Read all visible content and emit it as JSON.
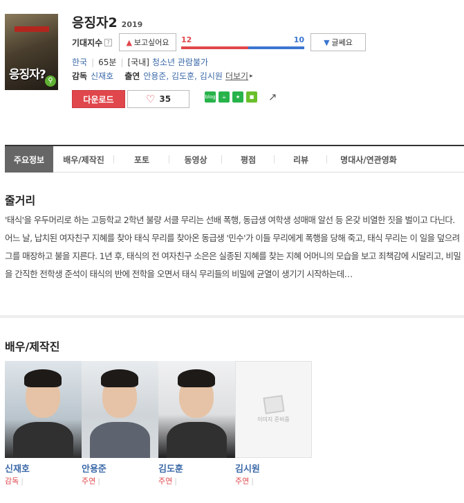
{
  "movie": {
    "title": "응징자2",
    "year": "2019",
    "poster_text": "응징자?"
  },
  "expect": {
    "label": "기대지수",
    "help": "?",
    "want_label": "보고싶어요",
    "dunno_label": "글쎄요",
    "want_count": "12",
    "dunno_count": "10",
    "want_ratio": 0.545
  },
  "meta": {
    "country": "한국",
    "runtime": "65분",
    "rating_prefix": "[국내]",
    "rating": "청소년 관람불가",
    "director_label": "감독",
    "director": "신재호",
    "cast_label": "출연",
    "cast_list": "안용준, 김도훈, 김시원",
    "more_label": "더보기"
  },
  "actions": {
    "download_label": "다운로드",
    "like_count": "35",
    "share_items": [
      "blog",
      "cafe",
      "star",
      "me"
    ]
  },
  "tabs": [
    {
      "label": "주요정보"
    },
    {
      "label": "배우/제작진"
    },
    {
      "label": "포토"
    },
    {
      "label": "동영상"
    },
    {
      "label": "평점"
    },
    {
      "label": "리뷰"
    },
    {
      "label": "명대사/연관영화"
    }
  ],
  "synopsis": {
    "title": "줄거리",
    "text": "'태식'을 우두머리로 하는 고등학교 2학년 불량 서클 무리는 선배 폭행, 동급생 여학생 성매매 알선 등 온갖 비열한 짓을 벌이고 다닌다. 어느 날, 납치된 여자친구 지혜를 찾아 태식 무리를 찾아온 동급생 '민수'가 이들 무리에게 폭행을 당해 죽고, 태식 무리는 이 일을 덮으려 그를 매장하고 불을 지른다. 1년 후, 태식의 전 여자친구 소은은 실종된 지혜를 찾는 지혜 어머니의 모습을 보고 죄책감에 시달리고, 비밀을 간직한 전학생 준석이 태식의 반에 전학을 오면서 태식 무리들의 비밀에 균열이 생기기 시작하는데…"
  },
  "cast_section": {
    "title": "배우/제작진",
    "no_image_label": "이미지 준비중",
    "people": [
      {
        "name": "신재호",
        "role": "감독"
      },
      {
        "name": "안용준",
        "role": "주연"
      },
      {
        "name": "김도훈",
        "role": "주연"
      },
      {
        "name": "김시원",
        "role": "주연"
      }
    ]
  }
}
